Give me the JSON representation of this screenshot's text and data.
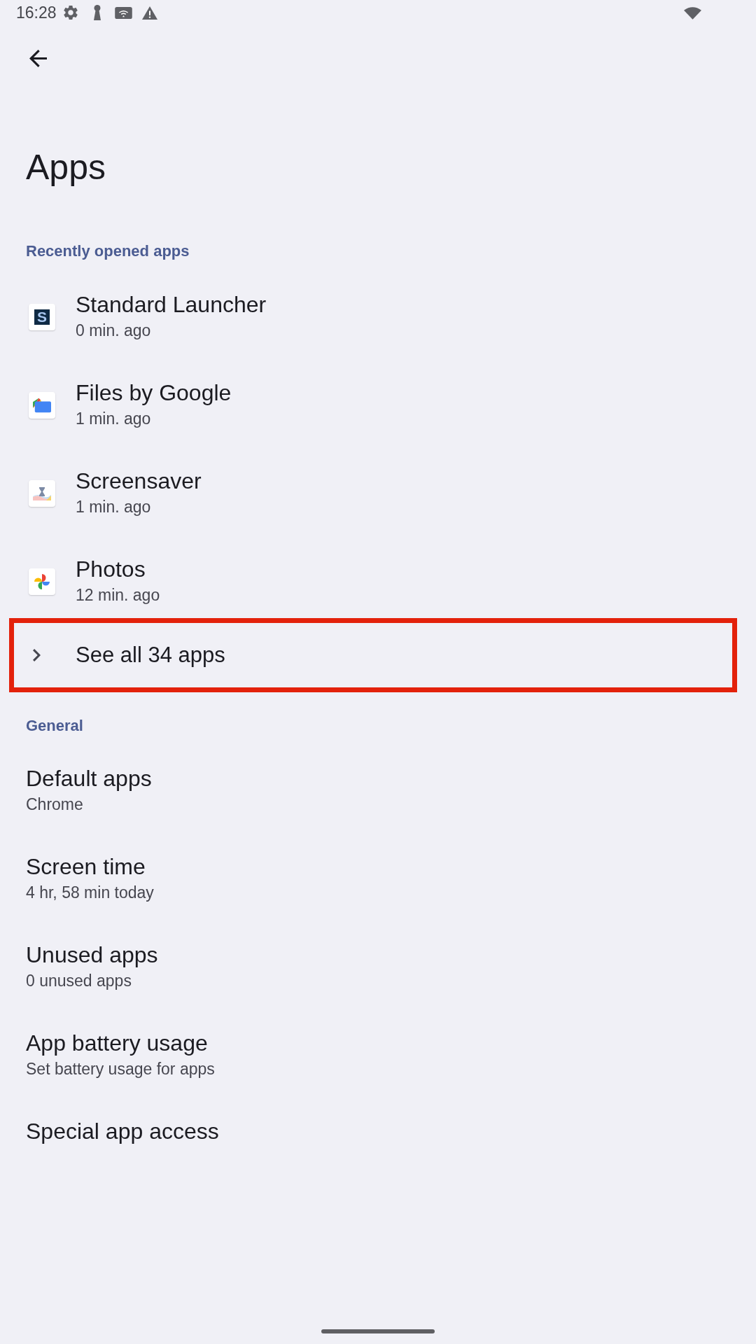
{
  "status_bar": {
    "time": "16:28"
  },
  "title": "Apps",
  "recent": {
    "header": "Recently opened apps",
    "apps": [
      {
        "name": "Standard Launcher",
        "last_opened": "0 min. ago",
        "kind": "letter",
        "logo_letter": "S"
      },
      {
        "name": "Files by Google",
        "last_opened": "1 min. ago",
        "kind": "files"
      },
      {
        "name": "Screensaver",
        "last_opened": "1 min. ago",
        "kind": "screensaver"
      },
      {
        "name": "Photos",
        "last_opened": "12 min. ago",
        "kind": "photos"
      }
    ],
    "see_all": {
      "label": "See all 34 apps",
      "highlighted": true
    }
  },
  "general": {
    "header": "General",
    "items": [
      {
        "title": "Default apps",
        "summary": "Chrome"
      },
      {
        "title": "Screen time",
        "summary": "4 hr, 58 min today"
      },
      {
        "title": "Unused apps",
        "summary": "0 unused apps"
      },
      {
        "title": "App battery usage",
        "summary": "Set battery usage for apps"
      },
      {
        "title": "Special app access"
      }
    ]
  }
}
